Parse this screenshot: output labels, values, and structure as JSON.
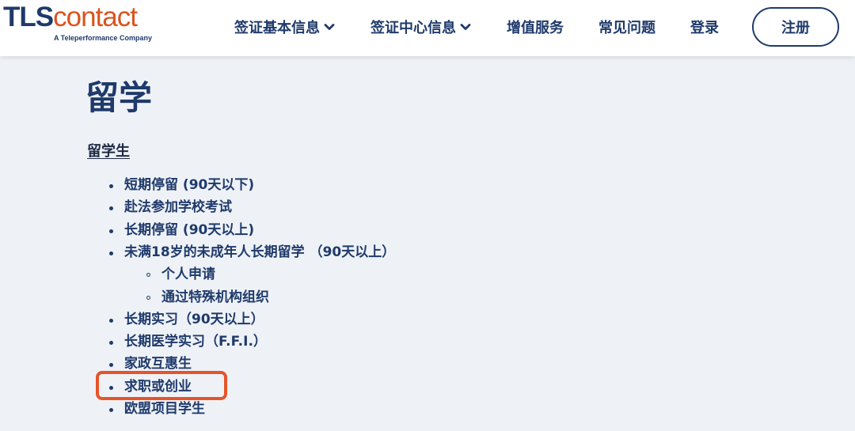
{
  "header": {
    "logo": {
      "brand_tls": "TLS",
      "brand_contact": "contact",
      "tagline": "A Teleperformance Company"
    },
    "nav": [
      {
        "label": "签证基本信息",
        "has_dropdown": true
      },
      {
        "label": "签证中心信息",
        "has_dropdown": true
      },
      {
        "label": "增值服务",
        "has_dropdown": false
      },
      {
        "label": "常见问题",
        "has_dropdown": false
      },
      {
        "label": "登录",
        "has_dropdown": false
      }
    ],
    "register_label": "注册"
  },
  "main": {
    "title": "留学",
    "section_heading": "留学生",
    "items": [
      {
        "label": "短期停留 (90天以下)",
        "level": 1
      },
      {
        "label": "赴法参加学校考试",
        "level": 1
      },
      {
        "label": "长期停留 (90天以上)",
        "level": 1
      },
      {
        "label": "未满18岁的未成年人长期留学 （90天以上）",
        "level": 1
      },
      {
        "label": "个人申请",
        "level": 2
      },
      {
        "label": "通过特殊机构组织",
        "level": 2
      },
      {
        "label": "长期实习（90天以上）",
        "level": 1
      },
      {
        "label": "长期医学实习（F.F.I.）",
        "level": 1
      },
      {
        "label": "家政互惠生",
        "level": 1
      },
      {
        "label": "求职或创业",
        "level": 1,
        "highlighted": true
      },
      {
        "label": "欧盟项目学生",
        "level": 1
      }
    ]
  },
  "colors": {
    "brand_navy": "#1f3a6b",
    "brand_orange": "#d9541f",
    "page_background": "#eef2f7",
    "highlight_annotation": "#e5542b"
  },
  "icons": {
    "nav_dropdown": "chevron-down-icon",
    "list_bullet": "bullet-icon",
    "sublist_bullet": "circle-bullet-icon"
  }
}
